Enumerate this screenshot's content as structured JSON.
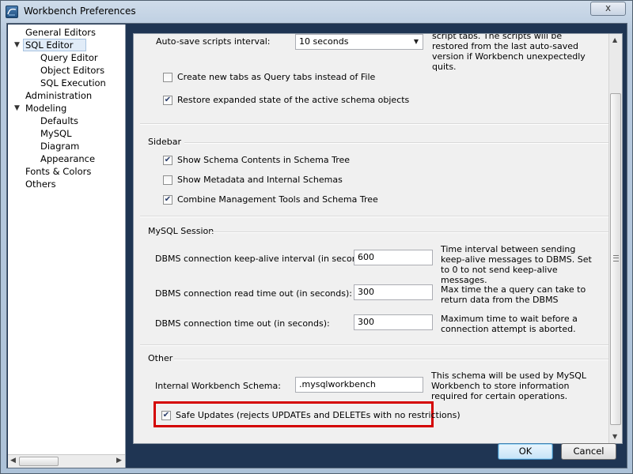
{
  "window": {
    "title": "Workbench Preferences",
    "close_symbol": "x"
  },
  "tree": {
    "items": [
      {
        "label": "General Editors",
        "level": 0
      },
      {
        "label": "SQL Editor",
        "level": 0,
        "expanded": true,
        "selected": true
      },
      {
        "label": "Query Editor",
        "level": 1
      },
      {
        "label": "Object Editors",
        "level": 1
      },
      {
        "label": "SQL Execution",
        "level": 1
      },
      {
        "label": "Administration",
        "level": 0
      },
      {
        "label": "Modeling",
        "level": 0,
        "expanded": true
      },
      {
        "label": "Defaults",
        "level": 1
      },
      {
        "label": "MySQL",
        "level": 1
      },
      {
        "label": "Diagram",
        "level": 1
      },
      {
        "label": "Appearance",
        "level": 1
      },
      {
        "label": "Fonts & Colors",
        "level": 0
      },
      {
        "label": "Others",
        "level": 0
      }
    ]
  },
  "autosave": {
    "label": "Auto-save scripts interval:",
    "value": "10 seconds",
    "help": "script tabs. The scripts will be restored from the last auto-saved version if Workbench unexpectedly quits."
  },
  "checkboxes_top": [
    {
      "label": "Create new tabs as Query tabs instead of File",
      "checked": false
    },
    {
      "label": "Restore expanded state of the active schema objects",
      "checked": true
    }
  ],
  "sidebar": {
    "heading": "Sidebar",
    "options": [
      {
        "label": "Show Schema Contents in Schema Tree",
        "checked": true
      },
      {
        "label": "Show Metadata and Internal Schemas",
        "checked": false
      },
      {
        "label": "Combine Management Tools and Schema Tree",
        "checked": true
      }
    ]
  },
  "session": {
    "heading": "MySQL Session",
    "fields": [
      {
        "label": "DBMS connection keep-alive interval (in seconds):",
        "value": "600",
        "help": "Time interval between sending keep-alive messages to DBMS. Set to 0 to not send keep-alive messages."
      },
      {
        "label": "DBMS connection read time out (in seconds):",
        "value": "300",
        "help": "Max time the a query can take to return data from the DBMS"
      },
      {
        "label": "DBMS connection time out (in seconds):",
        "value": "300",
        "help": "Maximum time to wait before a connection attempt is aborted."
      }
    ]
  },
  "other": {
    "heading": "Other",
    "schema_label": "Internal Workbench Schema:",
    "schema_value": ".mysqlworkbench",
    "schema_help": "This schema will be used by MySQL Workbench to store information required for certain operations.",
    "safe_updates": {
      "label": "Safe Updates (rejects UPDATEs and DELETEs with no restrictions)",
      "checked": true
    }
  },
  "buttons": {
    "ok": "OK",
    "cancel": "Cancel"
  },
  "colors": {
    "highlight": "#d40000",
    "window_bg": "#1f3553"
  },
  "icons": {
    "check": "✔",
    "tree_expanded": "▼",
    "scroll_up": "▲",
    "scroll_down": "▼",
    "scroll_left": "◀",
    "scroll_right": "▶",
    "dropdown": "▼"
  }
}
